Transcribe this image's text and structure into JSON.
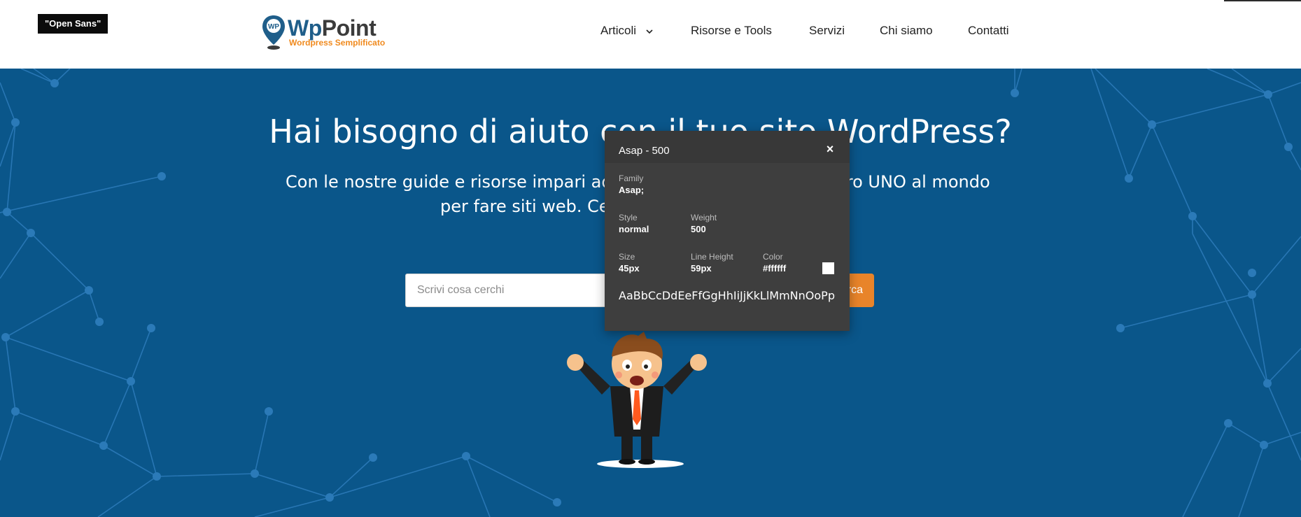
{
  "page": {
    "font_badge": "\"Open Sans\""
  },
  "logo": {
    "title_part1": "Wp",
    "title_part2": "Point",
    "tagline": "Wordpress Semplificato",
    "pin_text": "WP",
    "icon": "map-pin-icon"
  },
  "nav": {
    "items": [
      {
        "label": "Articoli",
        "has_dropdown": true
      },
      {
        "label": "Risorse e Tools"
      },
      {
        "label": "Servizi"
      },
      {
        "label": "Chi siamo"
      },
      {
        "label": "Contatti"
      }
    ]
  },
  "hero": {
    "title": "Hai bisogno di aiuto con il tuo sito WordPress?",
    "subtitle_line1_left": "Con le nostre guide e risorse impari ad us",
    "subtitle_line1_right": "ero UNO al mondo",
    "subtitle_line2_left": "per fare siti web. Cerc",
    "background_color": "#0a568a"
  },
  "search": {
    "placeholder": "Scrivi cosa cerchi",
    "button_label_visible": "rca"
  },
  "font_inspector": {
    "title": "Asap - 500",
    "close_icon": "close-icon",
    "family_label": "Family",
    "family_value": "Asap;",
    "style_label": "Style",
    "style_value": "normal",
    "weight_label": "Weight",
    "weight_value": "500",
    "size_label": "Size",
    "size_value": "45px",
    "line_height_label": "Line Height",
    "line_height_value": "59px",
    "color_label": "Color",
    "color_value": "#ffffff",
    "sample": "AaBbCcDdEeFfGgHhIiJjKkLlMmNnOoPpQqRr"
  },
  "colors": {
    "accent": "#e8842a",
    "hero_bg": "#0a568a",
    "logo_blue": "#1f5e8a",
    "tooltip_bg": "#3e3e3e"
  }
}
